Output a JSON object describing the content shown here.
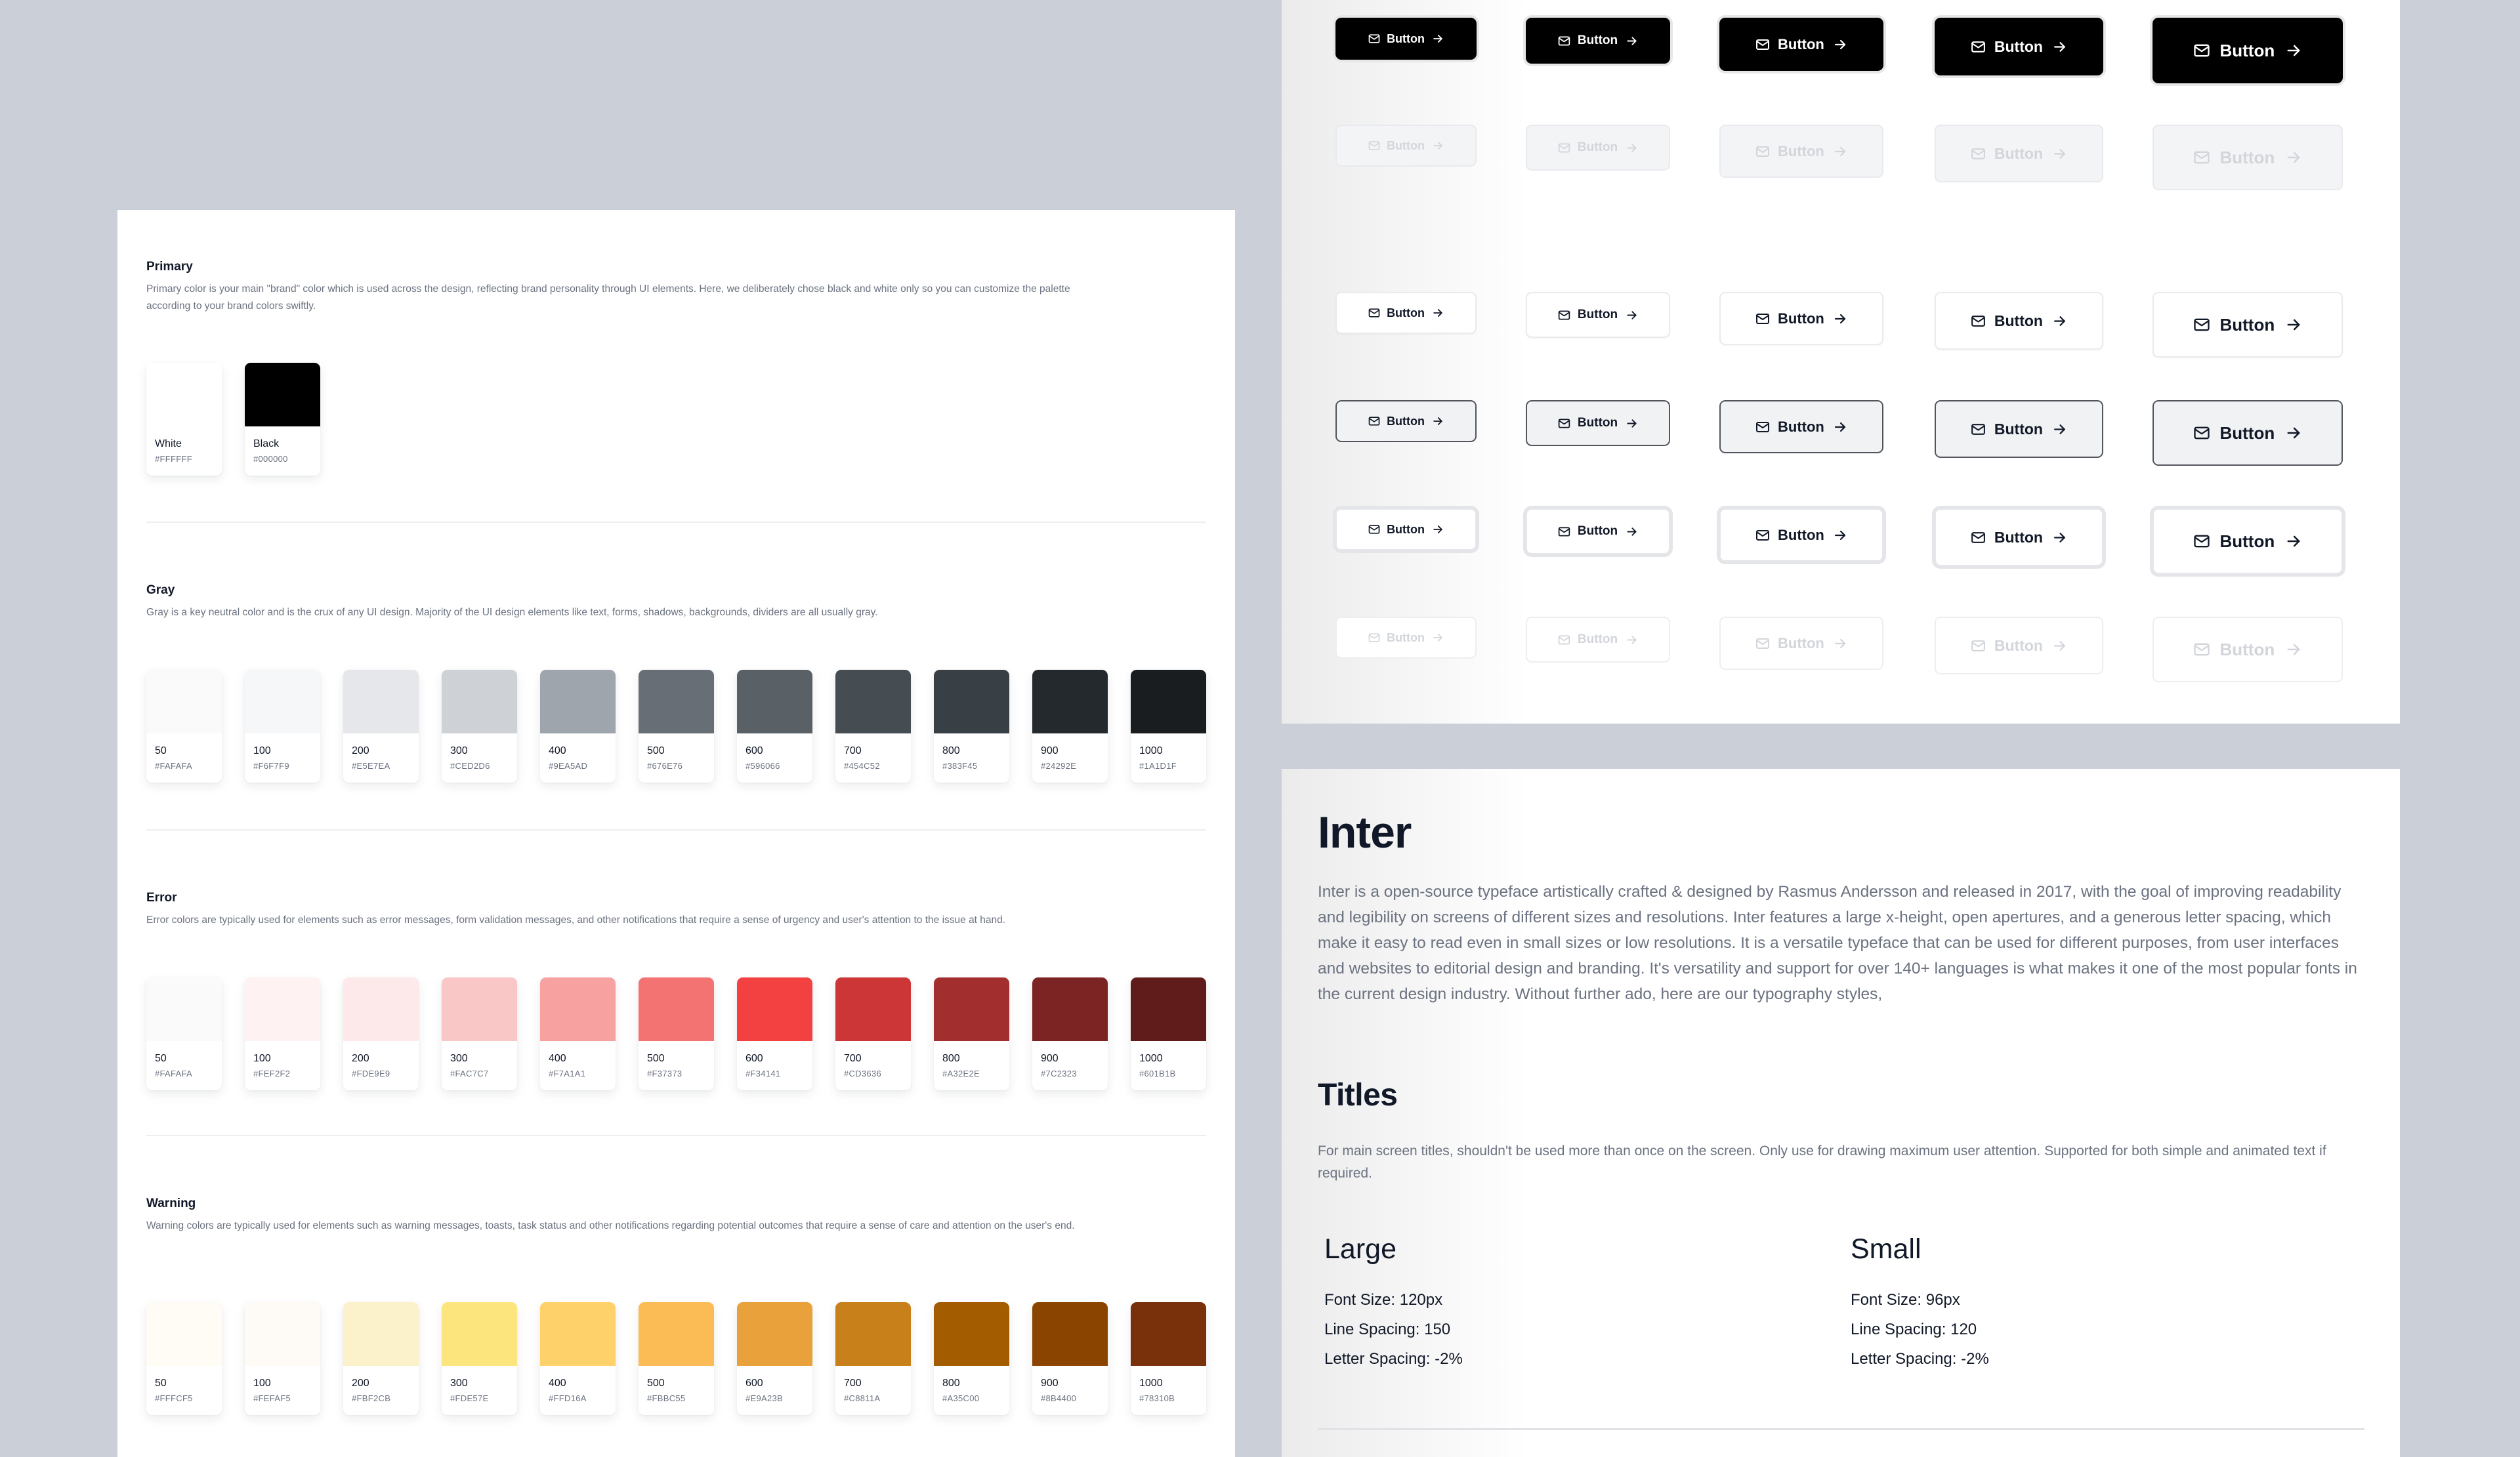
{
  "palette": {
    "primary": {
      "title": "Primary",
      "description": "Primary color is your main \"brand\" color which is used across the design, reflecting brand personality through UI elements. Here, we deliberately chose black and white only so you can customize the palette according to your brand colors swiftly.",
      "swatches": [
        {
          "name": "White",
          "hex": "#FFFFFF"
        },
        {
          "name": "Black",
          "hex": "#000000"
        }
      ]
    },
    "gray": {
      "title": "Gray",
      "description": "Gray is a key neutral color and is the crux of any UI design. Majority of the UI design elements like text, forms, shadows, backgrounds, dividers are all usually gray.",
      "swatches": [
        {
          "name": "50",
          "hex": "#FAFAFA"
        },
        {
          "name": "100",
          "hex": "#F6F7F9"
        },
        {
          "name": "200",
          "hex": "#E5E7EA"
        },
        {
          "name": "300",
          "hex": "#CED2D6"
        },
        {
          "name": "400",
          "hex": "#9EA5AD"
        },
        {
          "name": "500",
          "hex": "#676E76"
        },
        {
          "name": "600",
          "hex": "#596066"
        },
        {
          "name": "700",
          "hex": "#454C52"
        },
        {
          "name": "800",
          "hex": "#383F45"
        },
        {
          "name": "900",
          "hex": "#24292E"
        },
        {
          "name": "1000",
          "hex": "#1A1D1F"
        }
      ]
    },
    "error": {
      "title": "Error",
      "description": "Error colors are typically used for elements such as error messages, form validation messages, and other notifications that require a sense of urgency and user's attention to the issue at hand.",
      "swatches": [
        {
          "name": "50",
          "hex": "#FAFAFA"
        },
        {
          "name": "100",
          "hex": "#FEF2F2"
        },
        {
          "name": "200",
          "hex": "#FDE9E9"
        },
        {
          "name": "300",
          "hex": "#FAC7C7"
        },
        {
          "name": "400",
          "hex": "#F7A1A1"
        },
        {
          "name": "500",
          "hex": "#F37373"
        },
        {
          "name": "600",
          "hex": "#F34141"
        },
        {
          "name": "700",
          "hex": "#CD3636"
        },
        {
          "name": "800",
          "hex": "#A32E2E"
        },
        {
          "name": "900",
          "hex": "#7C2323"
        },
        {
          "name": "1000",
          "hex": "#601B1B"
        }
      ]
    },
    "warning": {
      "title": "Warning",
      "description": "Warning colors are typically used for elements such as warning messages, toasts, task status and other notifications regarding potential outcomes that require a sense of care and attention on the user's end.",
      "swatches": [
        {
          "name": "50",
          "hex": "#FFFCF5"
        },
        {
          "name": "100",
          "hex": "#FEFAF5"
        },
        {
          "name": "200",
          "hex": "#FBF2CB"
        },
        {
          "name": "300",
          "hex": "#FDE57E"
        },
        {
          "name": "400",
          "hex": "#FFD16A"
        },
        {
          "name": "500",
          "hex": "#FBBC55"
        },
        {
          "name": "600",
          "hex": "#E9A23B"
        },
        {
          "name": "700",
          "hex": "#C8811A"
        },
        {
          "name": "800",
          "hex": "#A35C00"
        },
        {
          "name": "900",
          "hex": "#8B4400"
        },
        {
          "name": "1000",
          "hex": "#78310B"
        }
      ]
    }
  },
  "buttons": {
    "label": "Button",
    "leading_icon": "mail-icon",
    "trailing_icon": "arrow-right-icon",
    "sizes": [
      "xs",
      "sm",
      "md",
      "lg",
      "xl"
    ],
    "rows": [
      {
        "variant": "primary",
        "state": "focused",
        "disabled": false
      },
      {
        "variant": "primary",
        "state": "disabled",
        "disabled": true
      },
      {
        "variant": "secondary",
        "state": "default",
        "disabled": false
      },
      {
        "variant": "secondary",
        "state": "hover",
        "disabled": false
      },
      {
        "variant": "secondary",
        "state": "focused",
        "disabled": false
      },
      {
        "variant": "secondary",
        "state": "disabled",
        "disabled": true
      }
    ]
  },
  "typography": {
    "font_name": "Inter",
    "description": "Inter is a open-source typeface artistically crafted & designed by Rasmus Andersson and released in 2017, with the goal of improving readability and legibility on screens of different sizes and resolutions. Inter features a large x-height, open apertures, and a generous letter spacing, which make it easy to read even in small sizes or low resolutions. It is a versatile typeface that can be used for different purposes, from user interfaces and websites to editorial design and branding. It's versatility and support for over 140+ languages is what makes it one of the most popular fonts in the current design industry. Without further ado, here are our typography styles,",
    "titles": {
      "heading": "Titles",
      "description": "For main screen titles, shouldn't be used more than once on the screen. Only use for drawing maximum user attention. Supported for both simple and animated text if required.",
      "styles": [
        {
          "name": "Large",
          "font_size": "Font Size: 120px",
          "line_spacing": "Line Spacing: 150",
          "letter_spacing": "Letter Spacing: -2%"
        },
        {
          "name": "Small",
          "font_size": "Font Size: 96px",
          "line_spacing": "Line Spacing: 120",
          "letter_spacing": "Letter Spacing: -2%"
        }
      ]
    }
  }
}
